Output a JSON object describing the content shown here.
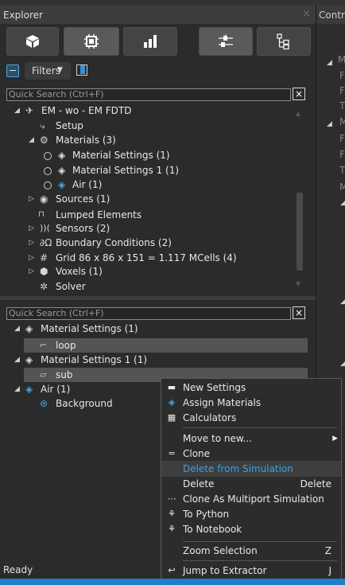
{
  "explorer": {
    "title": "Explorer",
    "close_glyph": "×"
  },
  "right_panel": {
    "title": "Control"
  },
  "toolbar": {
    "buttons": [
      {
        "name": "model-view-button",
        "icon": "cube-icon",
        "selected": false
      },
      {
        "name": "chip-view-button",
        "icon": "chip-icon",
        "selected": true
      },
      {
        "name": "results-view-button",
        "icon": "bar-chart-icon",
        "selected": false
      },
      {
        "name": "settings-view-button",
        "icon": "sliders-icon",
        "selected": true
      },
      {
        "name": "hierarchy-view-button",
        "icon": "hierarchy-icon",
        "selected": false
      }
    ]
  },
  "filter": {
    "label": "Filters"
  },
  "search_top": {
    "placeholder": "Quick Search (Ctrl+F)",
    "clear": "×"
  },
  "tree": {
    "root": "EM - wo - EM FDTD",
    "setup": "Setup",
    "materials": "Materials (3)",
    "material_items": [
      "Material Settings (1)",
      "Material Settings 1 (1)",
      "Air (1)"
    ],
    "sources": "Sources (1)",
    "lumped": "Lumped Elements",
    "sensors": "Sensors (2)",
    "boundary": "Boundary Conditions (2)",
    "grid": "Grid 86 x 86 x 151 = 1.117 MCells (4)",
    "voxels": "Voxels (1)",
    "solver": "Solver"
  },
  "search_bottom": {
    "placeholder": "Quick Search (Ctrl+F)",
    "clear": "×"
  },
  "entities": {
    "groups": [
      {
        "label": "Material Settings (1)",
        "child": "loop"
      },
      {
        "label": "Material Settings 1 (1)",
        "child": "sub"
      },
      {
        "label": "Air (1)",
        "child": "Background"
      }
    ]
  },
  "context_menu": {
    "items": [
      {
        "label": "New Settings",
        "icon": "new-settings-icon",
        "shortcut": ""
      },
      {
        "label": "Assign Materials",
        "icon": "assign-materials-icon",
        "shortcut": ""
      },
      {
        "label": "Calculators",
        "icon": "calculator-icon",
        "shortcut": ""
      },
      {
        "label": "Move to new...",
        "icon": "",
        "shortcut": "▶"
      },
      {
        "label": "Clone",
        "icon": "clone-icon",
        "shortcut": ""
      },
      {
        "label": "Delete from Simulation",
        "icon": "",
        "shortcut": ""
      },
      {
        "label": "Delete",
        "icon": "",
        "shortcut": "Delete"
      },
      {
        "label": "Clone As Multiport Simulation",
        "icon": "multiport-icon",
        "shortcut": ""
      },
      {
        "label": "To Python",
        "icon": "python-icon",
        "shortcut": ""
      },
      {
        "label": "To Notebook",
        "icon": "notebook-icon",
        "shortcut": ""
      },
      {
        "label": "Zoom Selection",
        "icon": "",
        "shortcut": "Z"
      },
      {
        "label": "Jump to Extractor",
        "icon": "jump-icon",
        "shortcut": "J"
      }
    ]
  },
  "status": {
    "text": "Ready"
  },
  "colors": {
    "accent": "#1f7fc8",
    "highlight_text": "#3aa0e8"
  }
}
